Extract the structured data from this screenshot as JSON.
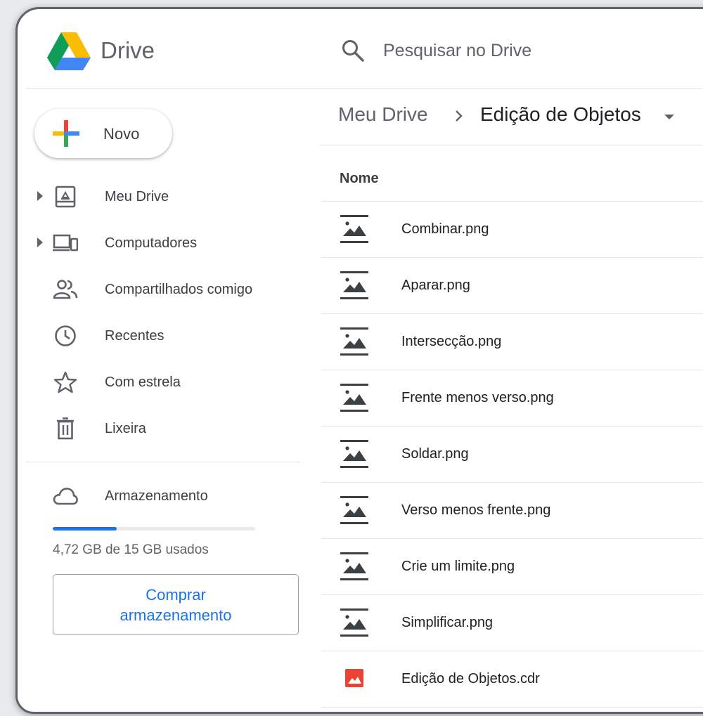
{
  "app": {
    "name": "Drive"
  },
  "search": {
    "placeholder": "Pesquisar no Drive"
  },
  "new_button": {
    "label": "Novo"
  },
  "sidebar": {
    "items": [
      {
        "label": "Meu Drive",
        "icon": "my-drive-icon",
        "expandable": true
      },
      {
        "label": "Computadores",
        "icon": "computers-icon",
        "expandable": true
      },
      {
        "label": "Compartilhados comigo",
        "icon": "shared-people-icon",
        "expandable": false
      },
      {
        "label": "Recentes",
        "icon": "clock-icon",
        "expandable": false
      },
      {
        "label": "Com estrela",
        "icon": "star-icon",
        "expandable": false
      },
      {
        "label": "Lixeira",
        "icon": "trash-icon",
        "expandable": false
      }
    ]
  },
  "storage": {
    "label": "Armazenamento",
    "icon": "cloud-icon",
    "used_text": "4,72 GB de 15 GB usados",
    "used_fraction": 0.315,
    "buy_line1": "Comprar",
    "buy_line2": "armazenamento"
  },
  "breadcrumb": {
    "root": "Meu Drive",
    "current": "Edição de Objetos"
  },
  "file_list": {
    "column_header": "Nome",
    "files": [
      {
        "name": "Combinar.png",
        "type": "image"
      },
      {
        "name": "Aparar.png",
        "type": "image"
      },
      {
        "name": "Intersecção.png",
        "type": "image"
      },
      {
        "name": "Frente menos verso.png",
        "type": "image"
      },
      {
        "name": "Soldar.png",
        "type": "image"
      },
      {
        "name": "Verso menos frente.png",
        "type": "image"
      },
      {
        "name": "Crie um limite.png",
        "type": "image"
      },
      {
        "name": "Simplificar.png",
        "type": "image"
      },
      {
        "name": "Edição de Objetos.cdr",
        "type": "drawing"
      }
    ]
  },
  "colors": {
    "accent": "#1a73e8",
    "text": "#3c4043",
    "muted": "#5f6368",
    "divider": "#e3e3e3",
    "cdr_red": "#ea4335"
  }
}
